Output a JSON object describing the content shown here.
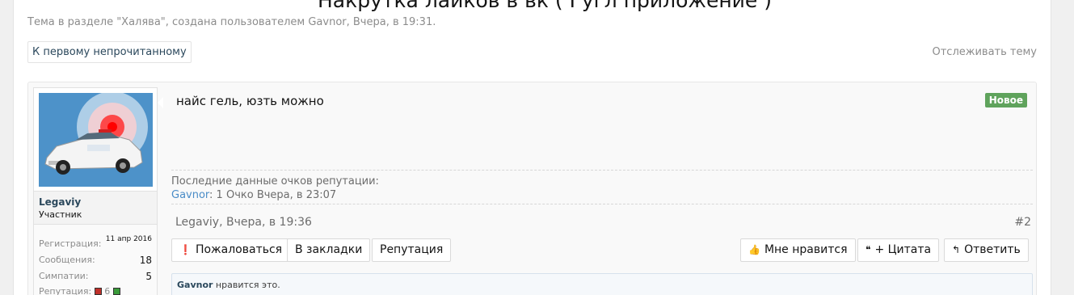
{
  "thread": {
    "title": "Накрутка лайков в вк ( Гугл приложение )",
    "meta": "Тема в разделе \"Халява\", создана пользователем Gavnor, Вчера, в 19:31.",
    "first_unread_label": "К первому непрочитанному",
    "watch_label": "Отслеживать тему"
  },
  "post": {
    "message": "найс гель, юзть можно",
    "new_badge": "Новое",
    "reputation": {
      "title": "Последние данные очков репутации:",
      "user": "Gavnor",
      "detail": ": 1 Очко Вчера, в 23:07"
    },
    "info": "Legaviy, Вчера, в 19:36",
    "number": "#2",
    "buttons": {
      "report": "Пожаловаться",
      "bookmark": "В закладки",
      "reputation": "Репутация",
      "like": "Мне нравится",
      "quote": "+ Цитата",
      "reply": "Ответить"
    },
    "likes": {
      "user": "Gavnor",
      "text": " нравится это."
    }
  },
  "user": {
    "name": "Legaviy",
    "title": "Участник",
    "stats": {
      "registration_label": "Регистрация:",
      "registration_value": "11 апр 2016",
      "messages_label": "Сообщения:",
      "messages_value": "18",
      "likes_label": "Симпатии:",
      "likes_value": "5",
      "reputation_label": "Репутация:",
      "reputation_value": "6"
    }
  },
  "icons": {
    "report": "exclamation-circle-icon",
    "like": "thumbs-up-icon",
    "quote": "quote-icon",
    "reply": "reply-icon",
    "rep_minus": "rep-minus-icon",
    "rep_plus": "rep-plus-icon"
  },
  "colors": {
    "new_badge": "#5fa35c",
    "link": "#4a8cc7",
    "username": "#2b485c"
  }
}
